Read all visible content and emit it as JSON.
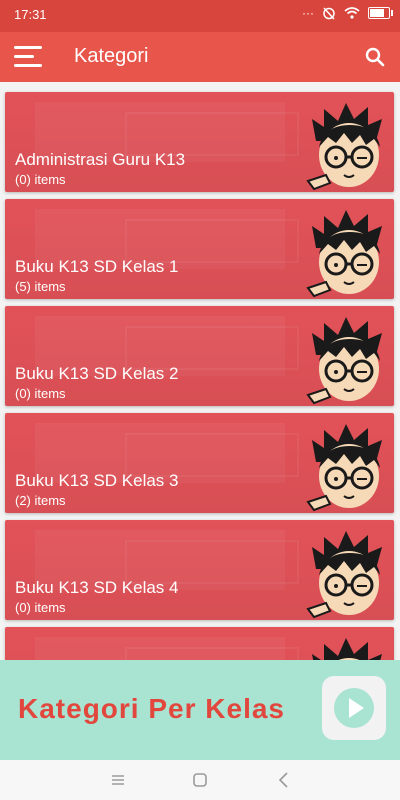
{
  "status": {
    "time": "17:31",
    "battery_level": 0.7
  },
  "appbar": {
    "title": "Kategori"
  },
  "categories": [
    {
      "title": "Administrasi Guru K13",
      "count": "(0) items"
    },
    {
      "title": "Buku K13 SD Kelas 1",
      "count": "(5) items"
    },
    {
      "title": "Buku K13 SD Kelas 2",
      "count": "(0) items"
    },
    {
      "title": "Buku K13 SD Kelas 3",
      "count": "(2) items"
    },
    {
      "title": "Buku K13 SD Kelas 4",
      "count": "(0) items"
    },
    {
      "title": "",
      "count": ""
    }
  ],
  "banner": {
    "text": "Kategori Per Kelas"
  },
  "colors": {
    "statusbar": "#d8453c",
    "appbar": "#e8554b",
    "card": "#e9555b",
    "banner": "#a9e3d2",
    "banner_text": "#e2473e"
  }
}
